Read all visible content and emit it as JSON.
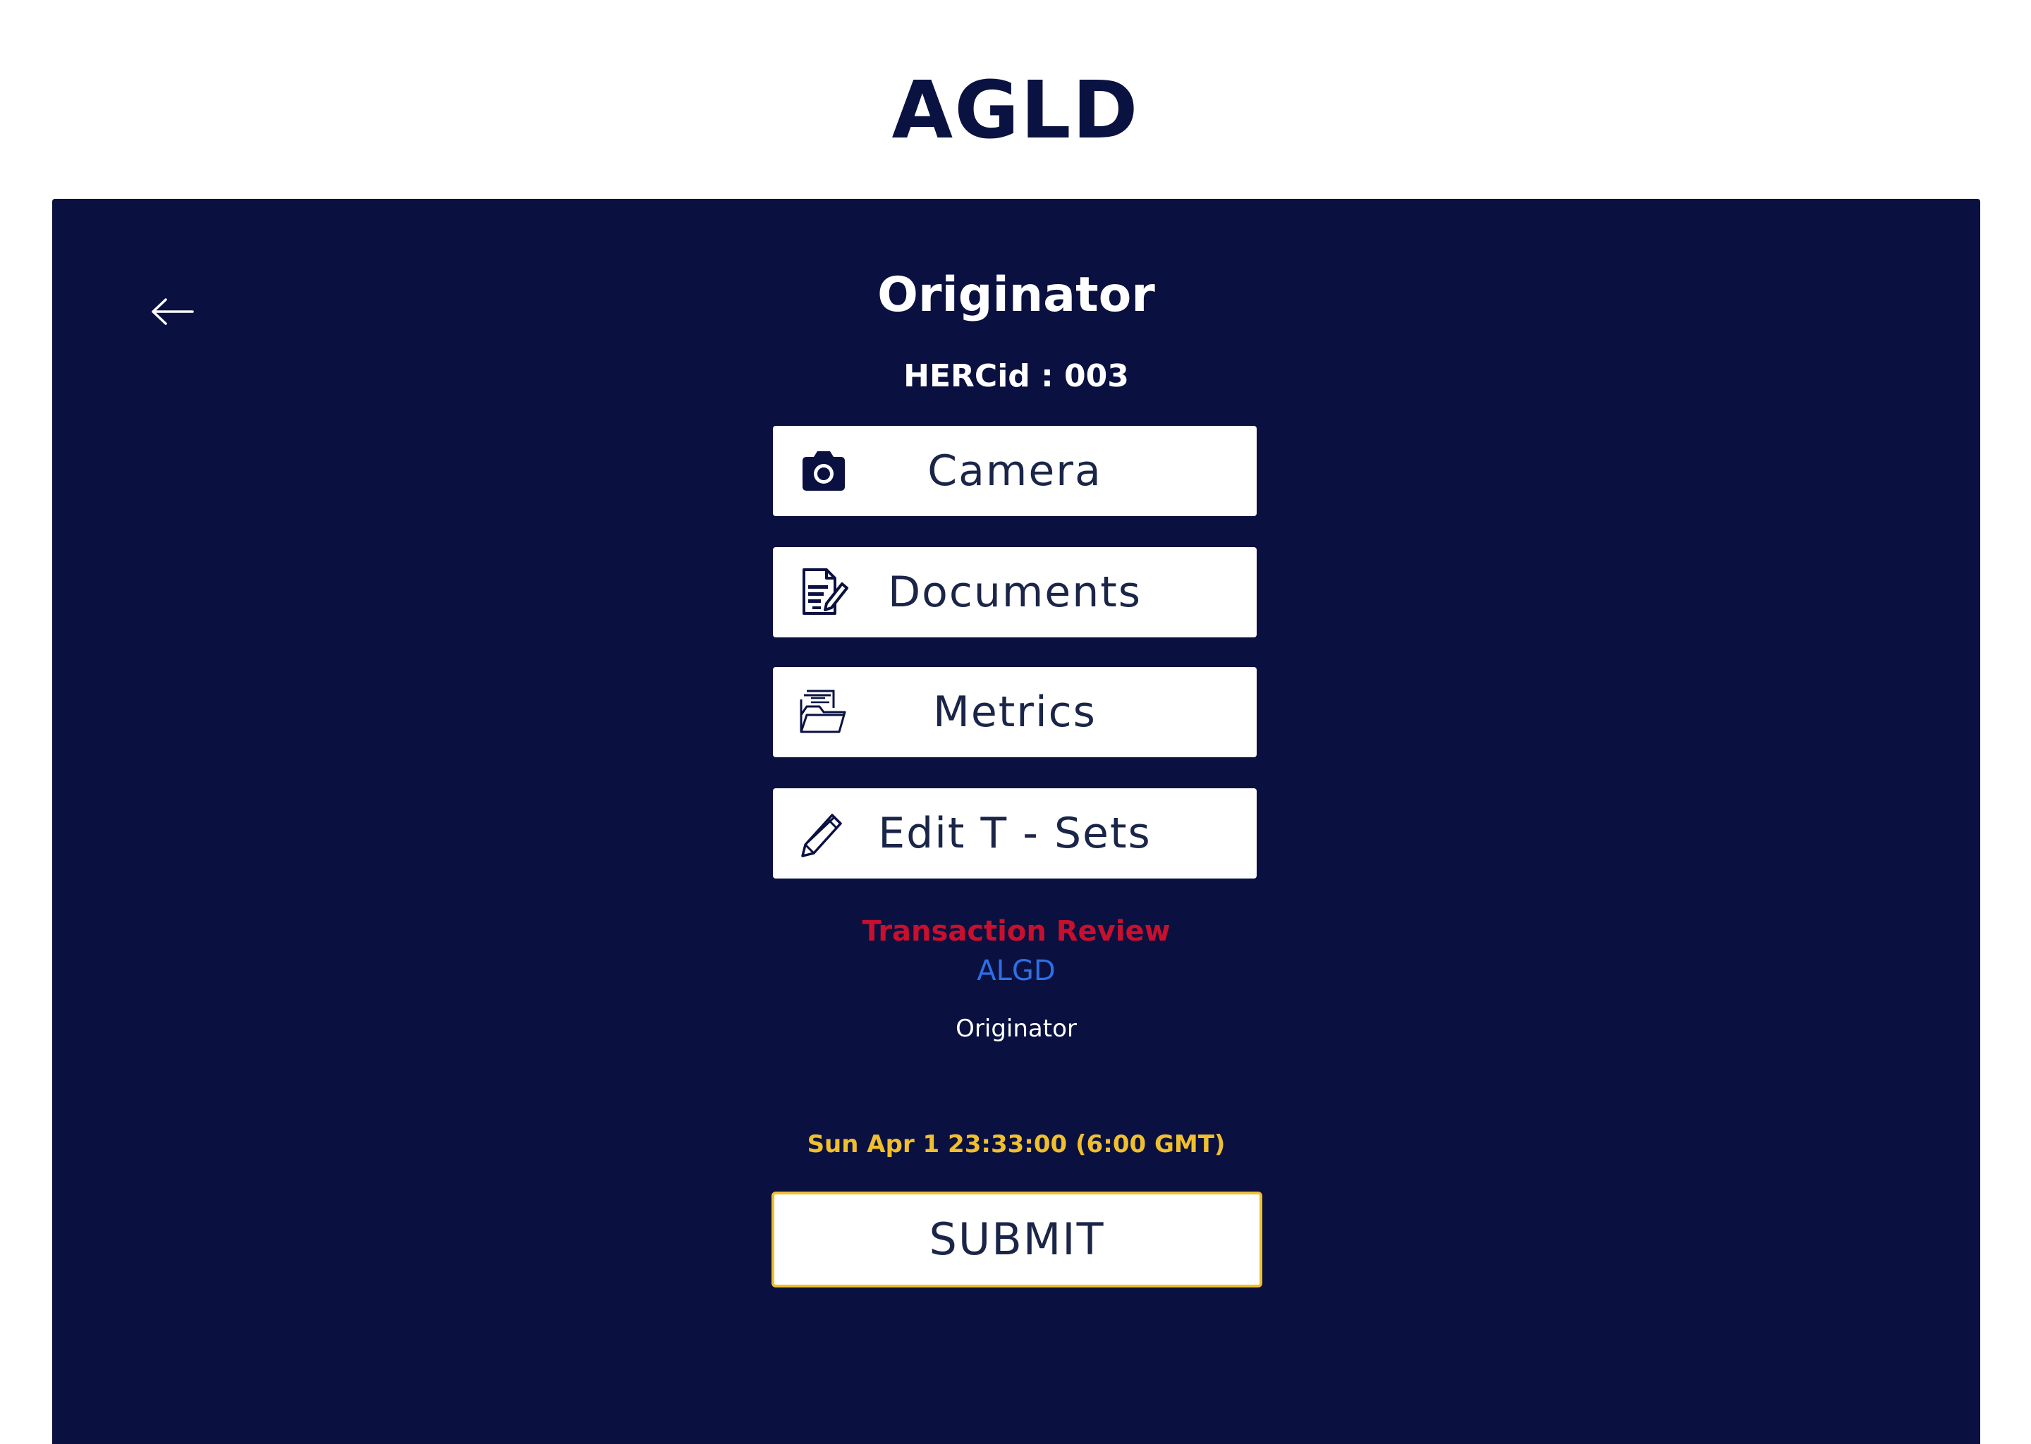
{
  "header": {
    "app_title": "AGLD"
  },
  "screen": {
    "title": "Originator",
    "hercid": "HERCid : 003"
  },
  "menu": [
    {
      "label": "Camera",
      "icon": "camera-icon"
    },
    {
      "label": "Documents",
      "icon": "document-edit-icon"
    },
    {
      "label": "Metrics",
      "icon": "folder-icon"
    },
    {
      "label": "Edit T - Sets",
      "icon": "pencil-icon"
    }
  ],
  "review": {
    "title": "Transaction Review",
    "code": "ALGD",
    "role": "Originator"
  },
  "timestamp": "Sun Apr 1 23:33:00 (6:00 GMT)",
  "submit_label": "SUBMIT",
  "colors": {
    "navy": "#0a1140",
    "title_text": "#0a1241",
    "review_red": "#c8102e",
    "link_blue": "#2e6fe6",
    "accent_yellow": "#f0bf2e"
  }
}
